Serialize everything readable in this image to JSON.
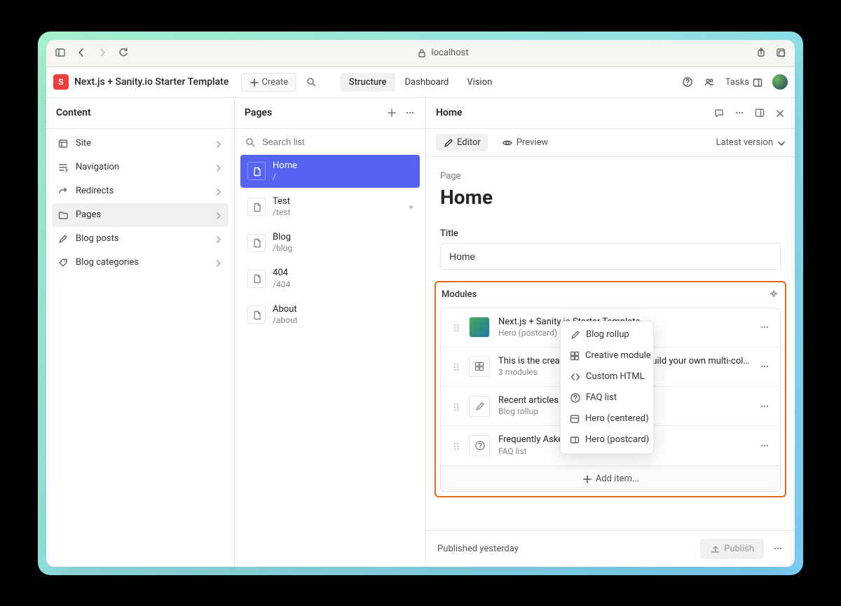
{
  "browser": {
    "address": "localhost"
  },
  "studio": {
    "logo_letter": "S",
    "title": "Next.js + Sanity.io Starter Template",
    "create_label": "Create",
    "tabs": {
      "structure": "Structure",
      "dashboard": "Dashboard",
      "vision": "Vision"
    },
    "tasks_label": "Tasks"
  },
  "panel1": {
    "title": "Content",
    "items": [
      {
        "label": "Site",
        "icon": "site"
      },
      {
        "label": "Navigation",
        "icon": "nav"
      },
      {
        "label": "Redirects",
        "icon": "redirect"
      },
      {
        "label": "Pages",
        "icon": "folder",
        "active": true
      },
      {
        "label": "Blog posts",
        "icon": "pencil"
      },
      {
        "label": "Blog categories",
        "icon": "tag"
      }
    ]
  },
  "panel2": {
    "title": "Pages",
    "search_placeholder": "Search list",
    "pages": [
      {
        "title": "Home",
        "slug": "/",
        "selected": true
      },
      {
        "title": "Test",
        "slug": "/test",
        "draft": true
      },
      {
        "title": "Blog",
        "slug": "/blog"
      },
      {
        "title": "404",
        "slug": "/404"
      },
      {
        "title": "About",
        "slug": "/about"
      }
    ]
  },
  "panel3": {
    "title": "Home",
    "editor_label": "Editor",
    "preview_label": "Preview",
    "version_label": "Latest version",
    "type_label": "Page",
    "doc_title": "Home",
    "fields": {
      "title_label": "Title",
      "title_value": "Home",
      "modules_label": "Modules"
    },
    "modules": [
      {
        "title": "Next.js + Sanity.io Starter Template",
        "subtitle": "Hero (postcard)",
        "icon": "image"
      },
      {
        "title": "This is the creative module. Use it to build your own multi-column bl...",
        "subtitle": "3 modules",
        "icon": "modules"
      },
      {
        "title": "Recent articles",
        "subtitle": "Blog rollup",
        "icon": "pencil"
      },
      {
        "title": "Frequently Asked",
        "subtitle": "FAQ list",
        "icon": "help"
      }
    ],
    "add_item_label": "Add item...",
    "popover": {
      "options": [
        {
          "label": "Blog rollup",
          "icon": "pencil"
        },
        {
          "label": "Creative module",
          "icon": "modules"
        },
        {
          "label": "Custom HTML",
          "icon": "code"
        },
        {
          "label": "FAQ list",
          "icon": "help"
        },
        {
          "label": "Hero (centered)",
          "icon": "layout"
        },
        {
          "label": "Hero (postcard)",
          "icon": "postcard"
        }
      ]
    },
    "footer": {
      "status": "Published yesterday",
      "publish_label": "Publish"
    }
  }
}
